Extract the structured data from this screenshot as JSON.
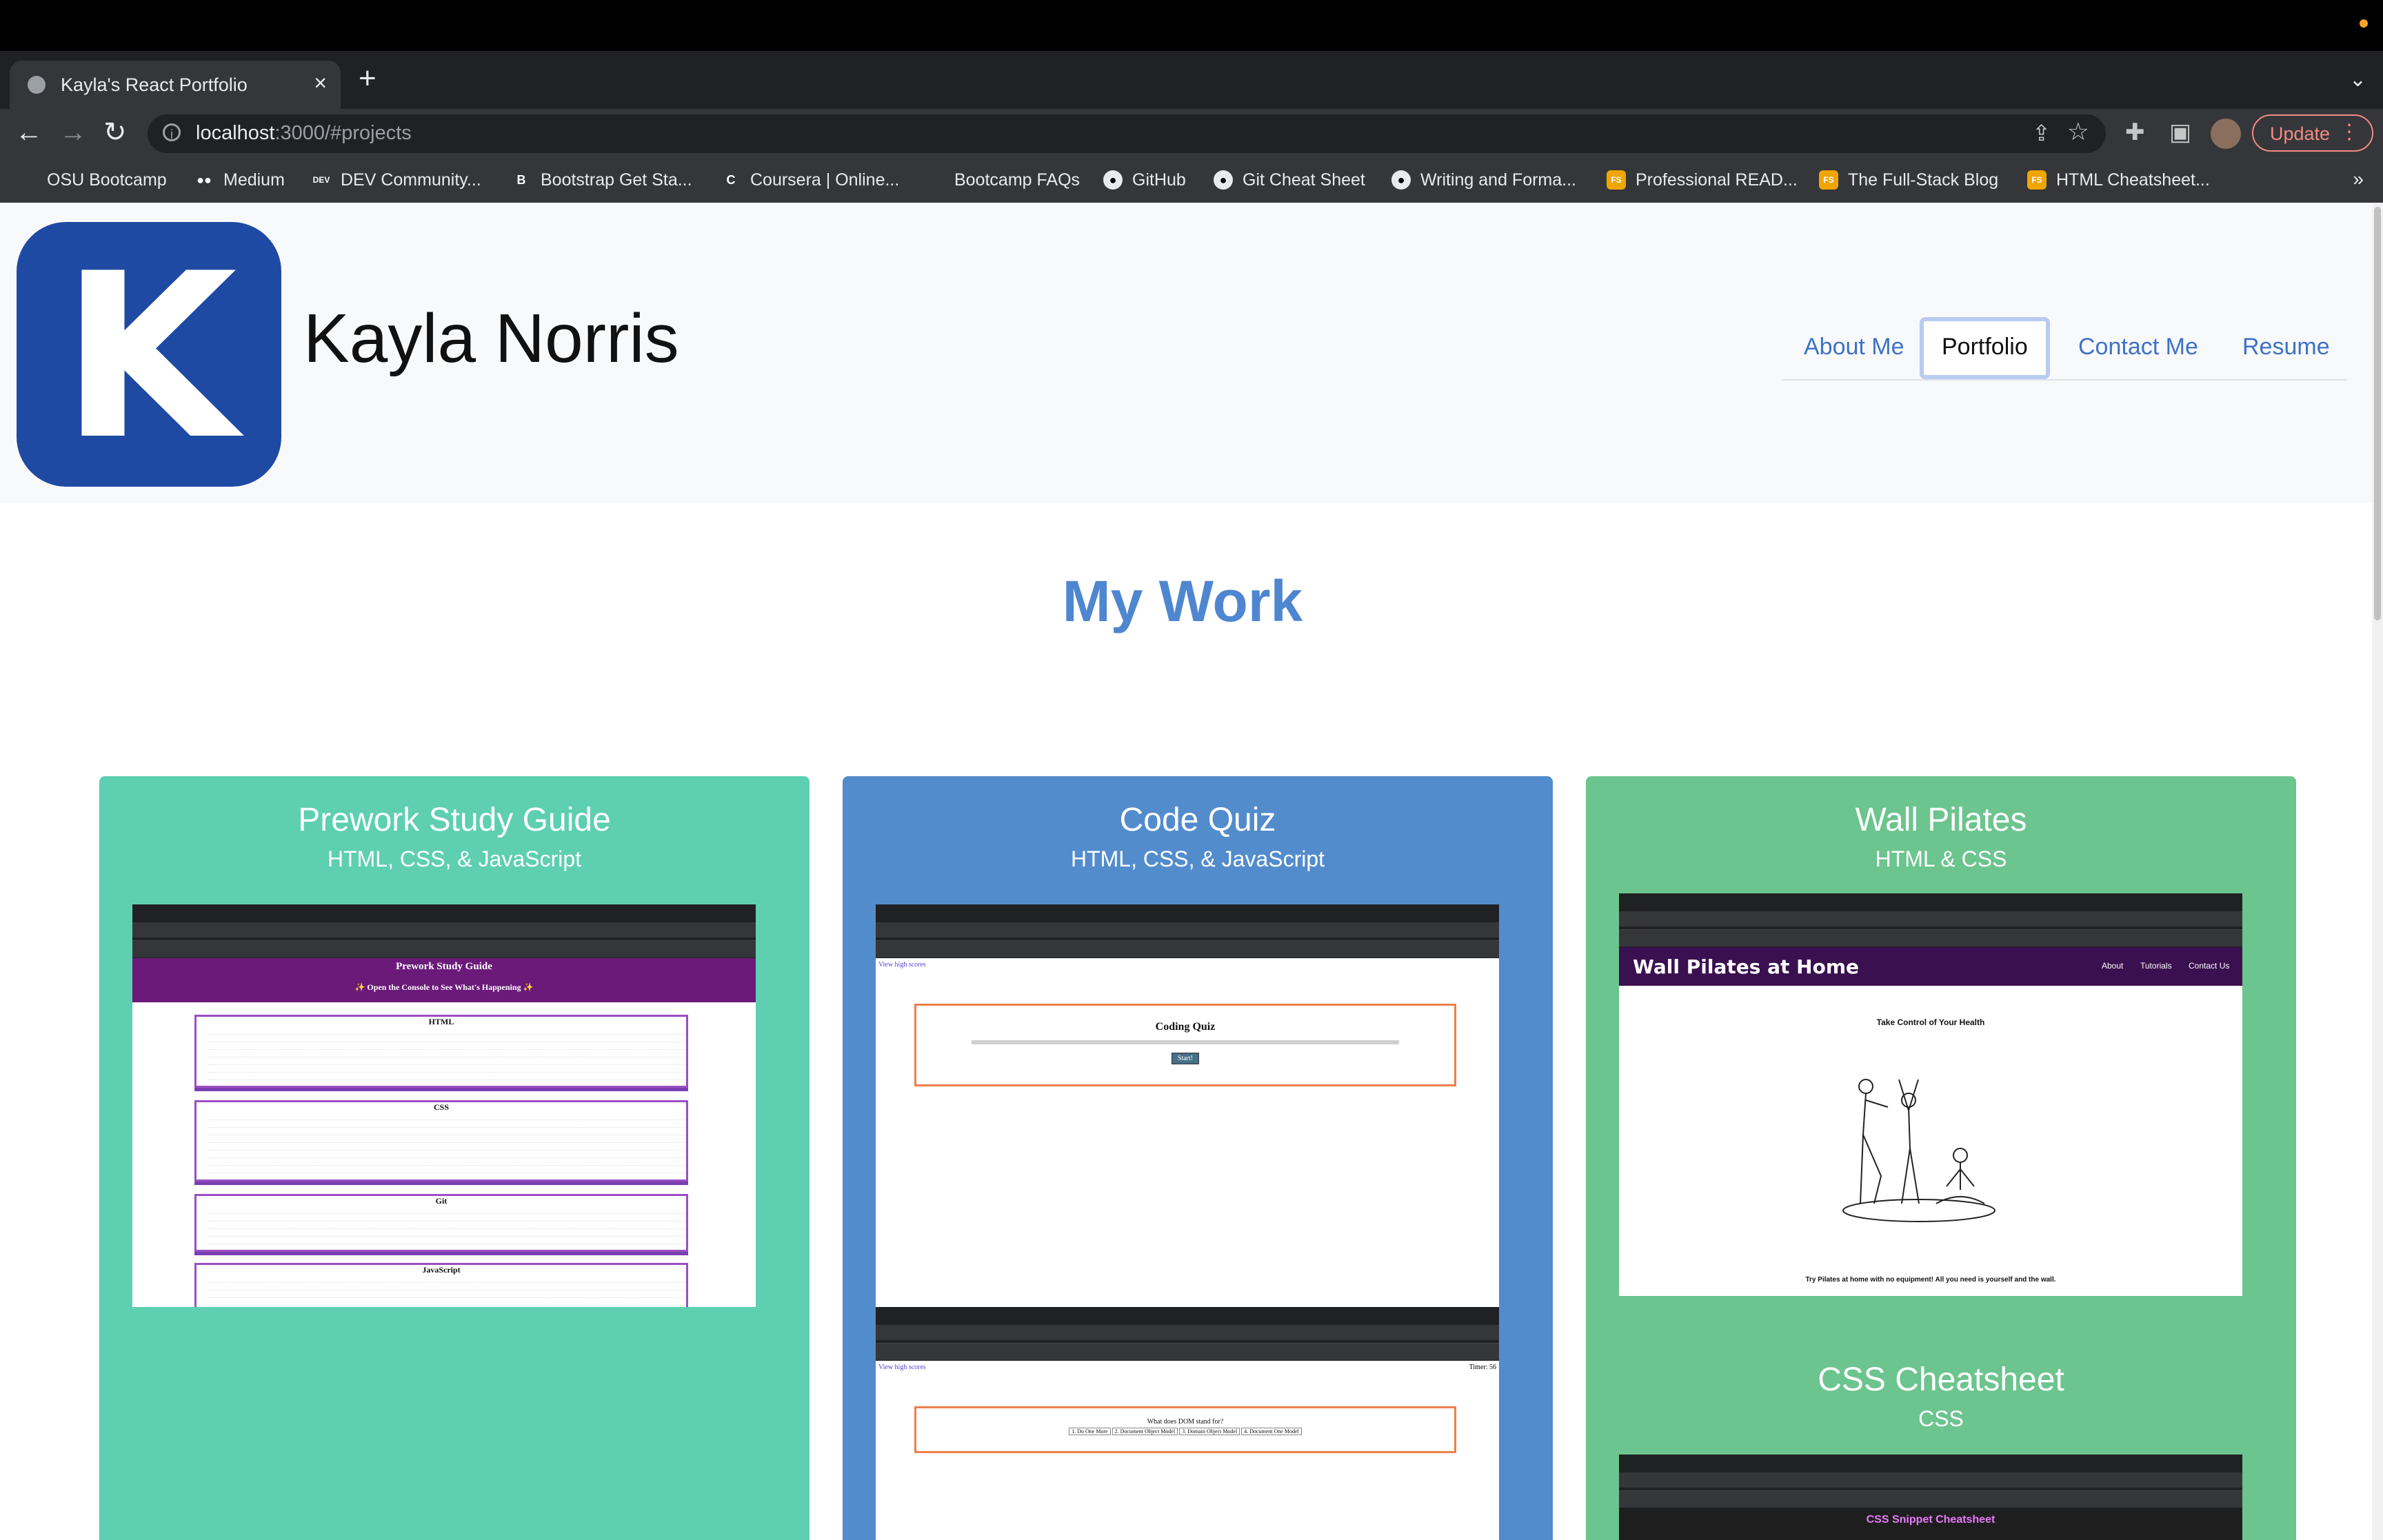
{
  "browser": {
    "tab_title": "Kayla's React Portfolio",
    "new_tab": "+",
    "close_tab": "×",
    "url_host": "localhost",
    "url_path": ":3000/#projects",
    "update_label": "Update",
    "bookmarks": [
      {
        "label": "OSU Bootcamp",
        "icon": "globe-icon",
        "color": "#9aa0a6"
      },
      {
        "label": "Medium",
        "icon": "medium-icon",
        "color": "#000000"
      },
      {
        "label": "DEV Community...",
        "icon": "dev-icon",
        "color": "#000000"
      },
      {
        "label": "Bootstrap Get Sta...",
        "icon": "bootstrap-icon",
        "color": "#7952b3"
      },
      {
        "label": "Coursera | Online...",
        "icon": "coursera-icon",
        "color": "#2a73cc"
      },
      {
        "label": "Bootcamp FAQs",
        "icon": "faq-icon",
        "color": "#333333"
      },
      {
        "label": "GitHub",
        "icon": "github-icon",
        "color": "#000000"
      },
      {
        "label": "Git Cheat Sheet",
        "icon": "github-icon",
        "color": "#333333"
      },
      {
        "label": "Writing and Forma...",
        "icon": "github-icon",
        "color": "#000000"
      },
      {
        "label": "Professional READ...",
        "icon": "fs-icon",
        "color": "#f0a500"
      },
      {
        "label": "The Full-Stack Blog",
        "icon": "fs-icon",
        "color": "#f0a500"
      },
      {
        "label": "HTML Cheatsheet...",
        "icon": "fs-icon",
        "color": "#f0a500"
      }
    ]
  },
  "site": {
    "name": "Kayla Norris",
    "logo_letter": "K",
    "nav": [
      "About Me",
      "Portfolio",
      "Contact Me",
      "Resume"
    ],
    "active_nav": "Portfolio"
  },
  "section_title": "My Work",
  "projects": [
    {
      "title": "Prework Study Guide",
      "subtitle": "HTML, CSS, & JavaScript",
      "color": "#5ecfb1",
      "shot": {
        "heading": "Prework Study Guide",
        "console_line": "✨ Open the Console to See What's Happening ✨",
        "sections": [
          "HTML",
          "CSS",
          "Git",
          "JavaScript"
        ]
      }
    },
    {
      "title": "Code Quiz",
      "subtitle": "HTML, CSS, & JavaScript",
      "color": "#528ccc",
      "shot": {
        "link": "View high scores",
        "heading": "Coding Quiz",
        "start": "Start!",
        "timer": "Timer: 56",
        "question": "What does DOM stand for?",
        "answers": [
          "1. Do One More",
          "2. Document Object Model",
          "3. Domain Object Model",
          "4. Document One Model"
        ]
      }
    },
    {
      "title": "Wall Pilates",
      "subtitle": "HTML & CSS",
      "color": "#6cc48e",
      "shot": {
        "heading": "Wall Pilates at Home",
        "nav": [
          "About",
          "Tutorials",
          "Contact Us"
        ],
        "tagline": "Take Control of Your Health",
        "cta": "Try Pilates at home with no equipment! All you need is yourself and the wall."
      }
    },
    {
      "title": "CSS Cheatsheet",
      "subtitle": "CSS",
      "shot": {
        "heading": "CSS Snippet Cheatsheet"
      }
    }
  ]
}
